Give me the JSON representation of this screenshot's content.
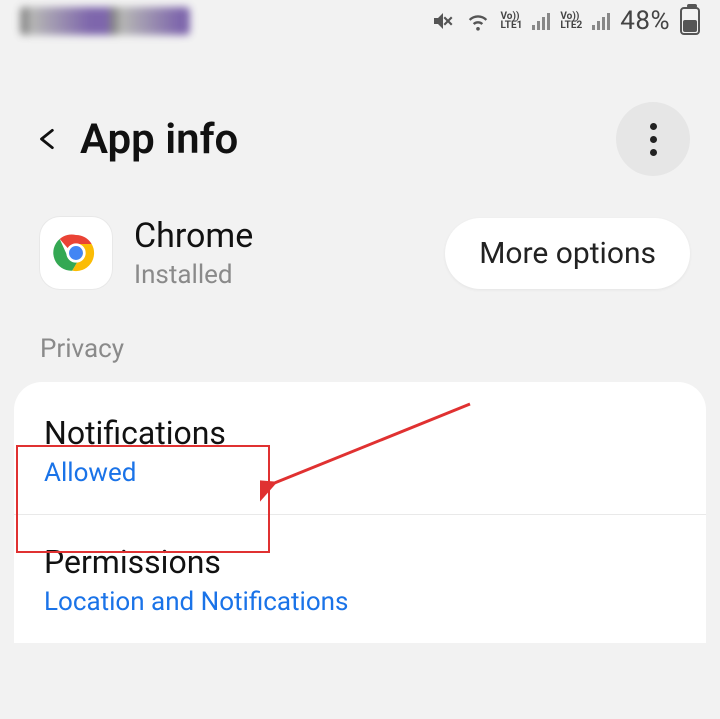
{
  "status": {
    "battery_pct": "48%",
    "lte1": "LTE1",
    "lte2": "LTE2",
    "vo": "Vo))"
  },
  "header": {
    "title": "App info"
  },
  "app": {
    "name": "Chrome",
    "status": "Installed",
    "more_options": "More options"
  },
  "section": {
    "privacy": "Privacy"
  },
  "rows": {
    "notifications": {
      "title": "Notifications",
      "sub": "Allowed"
    },
    "permissions": {
      "title": "Permissions",
      "sub": "Location and Notifications"
    }
  }
}
